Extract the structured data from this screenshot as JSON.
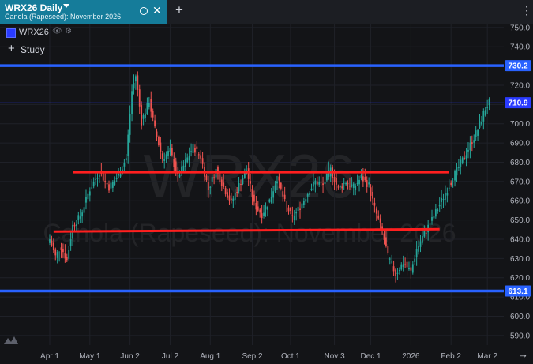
{
  "tab": {
    "title": "WRX26 Daily",
    "subtitle": "Canola (Rapeseed): November 2026",
    "close": "✕",
    "add": "+"
  },
  "menu_icon": "⋮",
  "legend": {
    "symbol": "WRX26",
    "color": "#2a3bff",
    "eye_icon": "eye-icon",
    "gear_icon": "gear-icon"
  },
  "study": {
    "plus": "+",
    "label": "Study"
  },
  "watermark": {
    "symbol": "WRX26",
    "description": "Canola (Rapeseed): November 2026"
  },
  "go_to_realtime": "→",
  "chart_data": {
    "type": "candlestick",
    "title": "",
    "xlabel": "",
    "ylabel": "",
    "ylim": [
      585,
      752
    ],
    "y_ticks": [
      590,
      600,
      610,
      620,
      630,
      640,
      650,
      660,
      670,
      680,
      690,
      700,
      710,
      720,
      730,
      740,
      750
    ],
    "x_ticks": [
      {
        "label": "Apr 1",
        "index": 0
      },
      {
        "label": "May 1",
        "index": 21
      },
      {
        "label": "Jun 2",
        "index": 42
      },
      {
        "label": "Jul 2",
        "index": 63
      },
      {
        "label": "Aug 1",
        "index": 84
      },
      {
        "label": "Sep 2",
        "index": 106
      },
      {
        "label": "Oct 1",
        "index": 126
      },
      {
        "label": "Nov 3",
        "index": 149
      },
      {
        "label": "Dec 1",
        "index": 168
      },
      {
        "label": "2026",
        "index": 189
      },
      {
        "label": "Feb 2",
        "index": 210
      },
      {
        "label": "Mar 2",
        "index": 229
      }
    ],
    "last_price": 710.9,
    "horizontal_lines": [
      {
        "value": 730.2,
        "color": "#2962ff",
        "label": "730.2"
      },
      {
        "value": 613.1,
        "color": "#2962ff",
        "label": "613.1"
      }
    ],
    "trend_lines": [
      {
        "from": {
          "index": 12,
          "value": 674.8
        },
        "to": {
          "index": 209,
          "value": 674.8
        },
        "color": "#ff1f1f"
      },
      {
        "from": {
          "index": 2,
          "value": 644
        },
        "to": {
          "index": 204,
          "value": 645.2
        },
        "color": "#ff1f1f"
      }
    ],
    "up_color": "#26a69a",
    "down_color": "#ef5350",
    "waypoints": [
      [
        0,
        640
      ],
      [
        3,
        631
      ],
      [
        6,
        636
      ],
      [
        9,
        629
      ],
      [
        12,
        647
      ],
      [
        16,
        652
      ],
      [
        21,
        666
      ],
      [
        26,
        675
      ],
      [
        31,
        667
      ],
      [
        36,
        673
      ],
      [
        40,
        682
      ],
      [
        43,
        717
      ],
      [
        45,
        725
      ],
      [
        48,
        701
      ],
      [
        52,
        712
      ],
      [
        55,
        697
      ],
      [
        59,
        682
      ],
      [
        63,
        686
      ],
      [
        67,
        672
      ],
      [
        71,
        680
      ],
      [
        75,
        688
      ],
      [
        79,
        683
      ],
      [
        83,
        666
      ],
      [
        87,
        676
      ],
      [
        91,
        667
      ],
      [
        95,
        659
      ],
      [
        99,
        668
      ],
      [
        103,
        676
      ],
      [
        107,
        658
      ],
      [
        111,
        653
      ],
      [
        115,
        660
      ],
      [
        119,
        672
      ],
      [
        123,
        659
      ],
      [
        127,
        651
      ],
      [
        131,
        657
      ],
      [
        135,
        664
      ],
      [
        139,
        670
      ],
      [
        143,
        668
      ],
      [
        147,
        676
      ],
      [
        151,
        666
      ],
      [
        155,
        670
      ],
      [
        159,
        667
      ],
      [
        163,
        672
      ],
      [
        167,
        668
      ],
      [
        170,
        656
      ],
      [
        174,
        644
      ],
      [
        177,
        631
      ],
      [
        181,
        622
      ],
      [
        185,
        628
      ],
      [
        189,
        623
      ],
      [
        192,
        635
      ],
      [
        196,
        643
      ],
      [
        200,
        650
      ],
      [
        204,
        658
      ],
      [
        208,
        666
      ],
      [
        212,
        674
      ],
      [
        216,
        681
      ],
      [
        220,
        689
      ],
      [
        224,
        697
      ],
      [
        228,
        708
      ],
      [
        230,
        711
      ]
    ]
  }
}
